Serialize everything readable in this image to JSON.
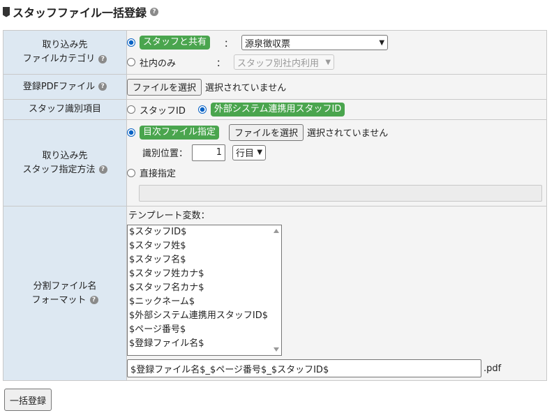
{
  "page": {
    "title": "スタッフファイル一括登録",
    "help_glyph": "?"
  },
  "category": {
    "label_line1": "取り込み先",
    "label_line2": "ファイルカテゴリ",
    "option_shared": "スタッフと共有",
    "option_internal": "社内のみ",
    "colon": "：",
    "shared_select_value": "源泉徴収票",
    "internal_select_value": "スタッフ別社内利用"
  },
  "pdf_file": {
    "label": "登録PDFファイル",
    "button": "ファイルを選択",
    "status": "選択されていません"
  },
  "staff_key": {
    "label": "スタッフ識別項目",
    "option_staff_id": "スタッフID",
    "option_external_id": "外部システム連携用スタッフID"
  },
  "staff_method": {
    "label_line1": "取り込み先",
    "label_line2": "スタッフ指定方法",
    "option_index": "目次ファイル指定",
    "button": "ファイルを選択",
    "status": "選択されていません",
    "position_label": "識別位置：",
    "position_value": "1",
    "position_unit": "行目",
    "option_direct": "直接指定",
    "direct_value": ""
  },
  "split_name": {
    "label_line1": "分割ファイル名",
    "label_line2": "フォーマット",
    "template_label": "テンプレート変数：",
    "variables": [
      "$スタッフID$",
      "$スタッフ姓$",
      "$スタッフ名$",
      "$スタッフ姓カナ$",
      "$スタッフ名カナ$",
      "$ニックネーム$",
      "$外部システム連携用スタッフID$",
      "$ページ番号$",
      "$登録ファイル名$"
    ],
    "format_value": "$登録ファイル名$_$ページ番号$_$スタッフID$",
    "extension": ".pdf"
  },
  "actions": {
    "submit": "一括登録"
  }
}
